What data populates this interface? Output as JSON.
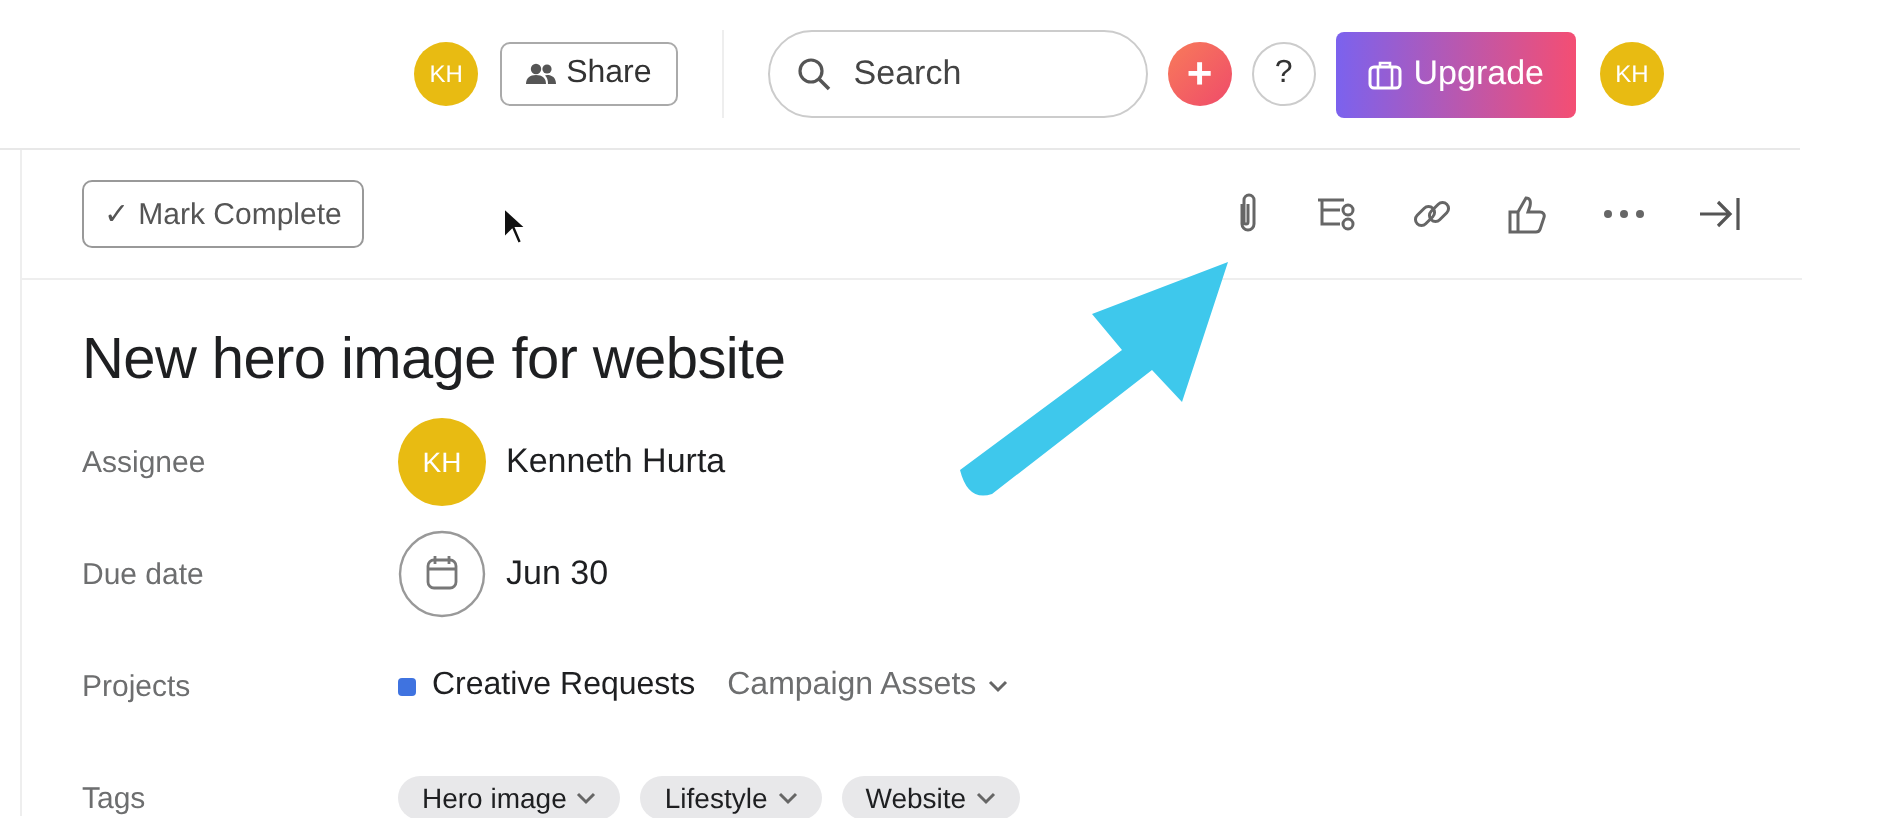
{
  "header": {
    "avatar_left": "KH",
    "share": "Share",
    "search": {
      "placeholder": "Search"
    },
    "add": "+",
    "help": "?",
    "upgrade": "Upgrade",
    "avatar_right": "KH"
  },
  "toolbar": {
    "mark_complete": "✓ Mark Complete"
  },
  "task": {
    "title": "New hero image for website",
    "fields": [
      {
        "kind": "person",
        "label": "Assignee",
        "initials": "KH",
        "value": "Kenneth Hurta"
      },
      {
        "kind": "date",
        "label": "Due date",
        "value": "Jun 30"
      },
      {
        "kind": "projects",
        "label": "Projects",
        "project": "Creative Requests",
        "color": "#3f73e0",
        "section": "Campaign Assets"
      },
      {
        "kind": "tags",
        "label": "Tags",
        "tags": [
          "Hero image",
          "Lifestyle",
          "Website"
        ]
      }
    ]
  }
}
